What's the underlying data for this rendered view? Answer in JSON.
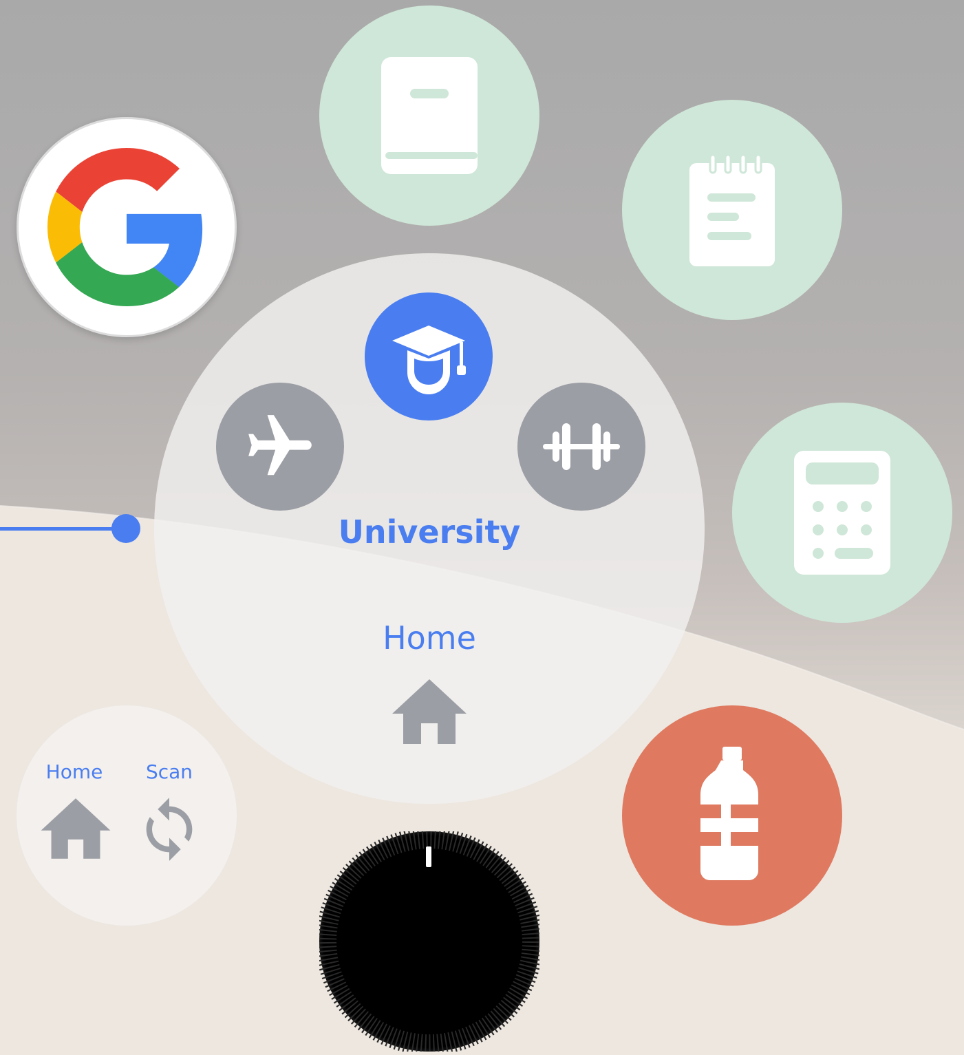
{
  "colors": {
    "accent": "#4a7ef0",
    "mint": "#cfe7d8",
    "grey_button": "#9b9ea4",
    "bottle": "#df7a60",
    "slider": "#4a7ef0"
  },
  "apps": [
    {
      "name": "google",
      "icon": "google-g-icon"
    },
    {
      "name": "book",
      "icon": "book-icon"
    },
    {
      "name": "notes",
      "icon": "notepad-icon"
    },
    {
      "name": "calculator",
      "icon": "calculator-icon"
    },
    {
      "name": "water",
      "icon": "water-bottle-icon"
    }
  ],
  "dial": {
    "selected_label": "University",
    "home_label": "Home",
    "modes": [
      {
        "icon": "airplane-icon",
        "selected": false
      },
      {
        "icon": "graduation-cap-icon",
        "selected": true
      },
      {
        "icon": "dumbbell-icon",
        "selected": false
      }
    ],
    "home_icon": "house-icon"
  },
  "mini_panel": {
    "home_label": "Home",
    "scan_label": "Scan",
    "home_icon": "house-icon",
    "scan_icon": "refresh-icon"
  },
  "knob": {
    "icon": "rotary-knob"
  }
}
